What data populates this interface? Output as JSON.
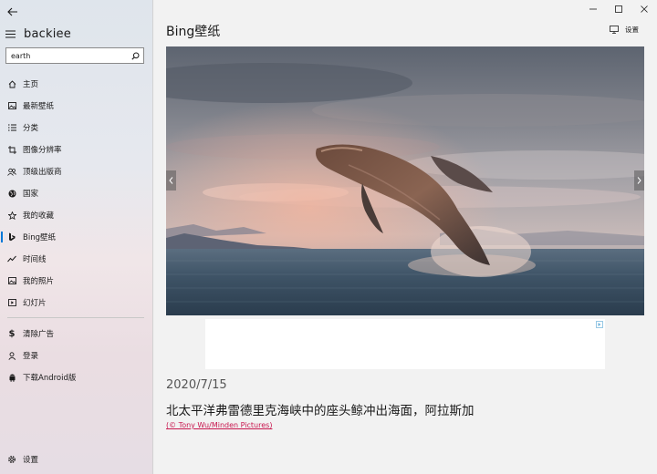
{
  "app": {
    "brand": "backiee"
  },
  "search": {
    "value": "earth",
    "placeholder": ""
  },
  "nav": {
    "items": [
      {
        "label": "主页",
        "icon": "home-icon"
      },
      {
        "label": "最新壁纸",
        "icon": "image-icon"
      },
      {
        "label": "分类",
        "icon": "list-icon"
      },
      {
        "label": "图像分辨率",
        "icon": "crop-icon"
      },
      {
        "label": "顶级出版商",
        "icon": "people-icon"
      },
      {
        "label": "国家",
        "icon": "globe-icon"
      },
      {
        "label": "我的收藏",
        "icon": "star-icon"
      },
      {
        "label": "Bing壁纸",
        "icon": "bing-icon",
        "active": true
      },
      {
        "label": "时间线",
        "icon": "trend-icon"
      },
      {
        "label": "我的照片",
        "icon": "photo-icon"
      },
      {
        "label": "幻灯片",
        "icon": "slideshow-icon"
      }
    ],
    "secondary": [
      {
        "label": "清除广告",
        "icon": "dollar-icon"
      },
      {
        "label": "登录",
        "icon": "user-icon"
      },
      {
        "label": "下载Android版",
        "icon": "android-icon"
      }
    ],
    "settings": {
      "label": "设置",
      "icon": "gear-icon"
    }
  },
  "header": {
    "title": "Bing壁纸",
    "settings_label": "设置"
  },
  "wallpaper": {
    "date": "2020/7/15",
    "caption": "北太平洋弗雷德里克海峡中的座头鲸冲出海面，阿拉斯加",
    "credit": "(© Tony Wu/Minden Pictures)"
  },
  "colors": {
    "accent": "#0078d7",
    "credit_link": "#c8164e"
  }
}
